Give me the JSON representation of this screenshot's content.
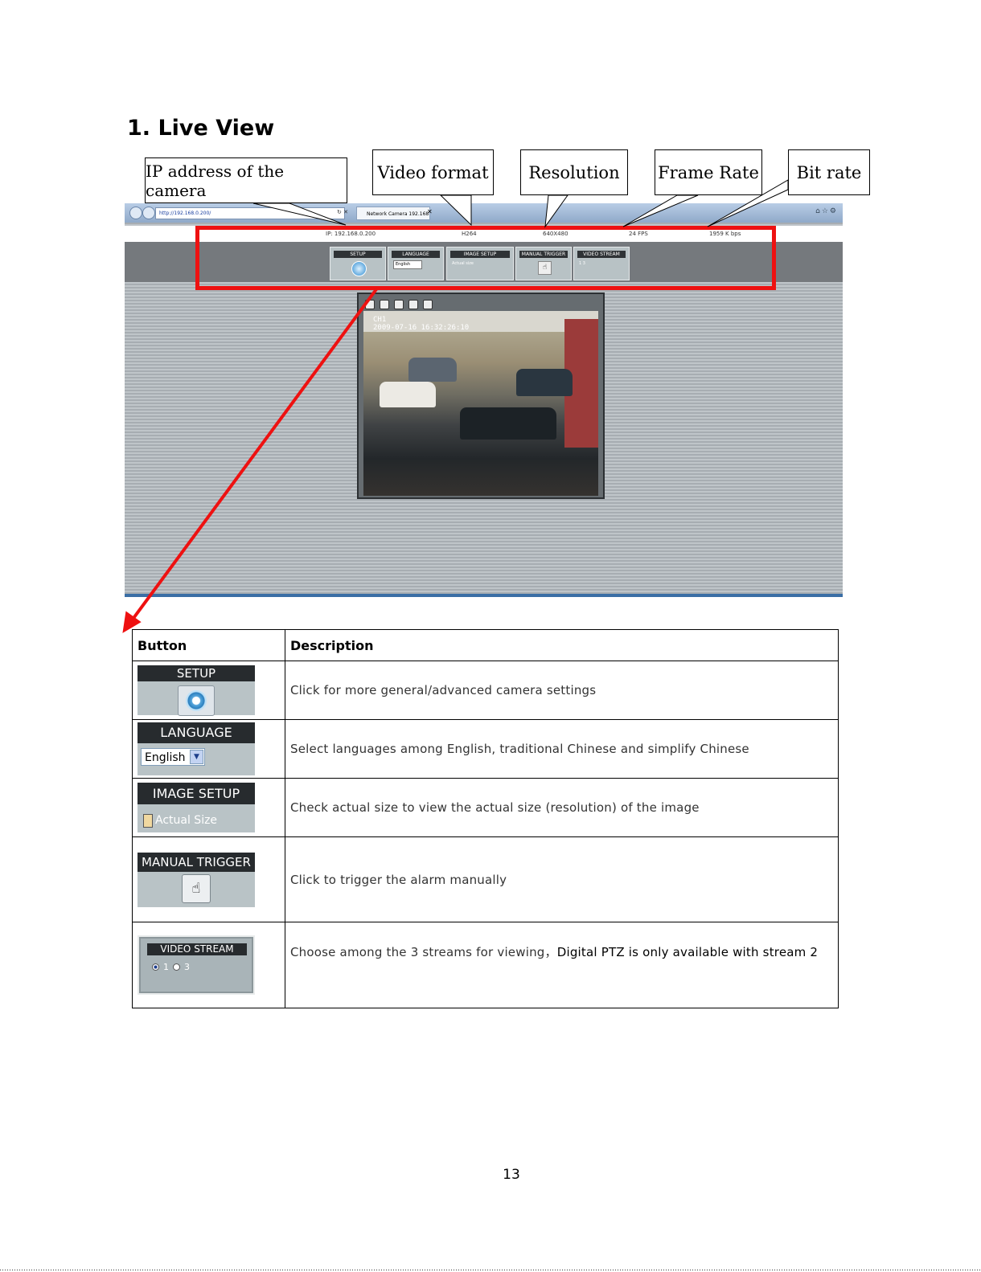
{
  "heading": "1. Live View",
  "callouts": {
    "ip": "IP address of the camera",
    "video_format": "Video format",
    "resolution": "Resolution",
    "frame_rate": "Frame Rate",
    "bit_rate": "Bit rate"
  },
  "screenshot": {
    "address_url": "http://192.168.0.200/",
    "tab_title": "Network Camera 192.168 ...",
    "status": {
      "ip": "IP: 192.168.0.200",
      "format": "H264",
      "resolution": "640X480",
      "fps": "24  FPS",
      "bitrate": "1959  K bps"
    },
    "panels": {
      "setup": "SETUP",
      "language": "LANGUAGE",
      "language_value": "English",
      "image_setup": "IMAGE SETUP",
      "image_setup_option": "Actual size",
      "manual_trigger": "MANUAL TRIGGER",
      "video_stream": "VIDEO STREAM",
      "stream_options": "1  3"
    },
    "osd_channel": "CH1",
    "osd_timestamp": "2009-07-16  16:32:26:10"
  },
  "table": {
    "headers": {
      "button": "Button",
      "description": "Description"
    },
    "rows": [
      {
        "button_label": "SETUP",
        "description": "Click for more general/advanced camera settings"
      },
      {
        "button_label": "LANGUAGE",
        "select_value": "English",
        "description": "Select languages among English, traditional Chinese and simplify Chinese"
      },
      {
        "button_label": "IMAGE SETUP",
        "checkbox_label": "Actual Size",
        "description": "Check actual size to view the actual size (resolution) of the image"
      },
      {
        "button_label": "MANUAL TRIGGER",
        "description": "Click to trigger the alarm manually"
      },
      {
        "button_label": "VIDEO STREAM",
        "radio_1": "1",
        "radio_2": "3",
        "description": "Choose among the 3 streams for viewing，",
        "description_emph": "Digital PTZ is only available with stream 2"
      }
    ]
  },
  "page_number": "13",
  "colors": {
    "highlight": "#ee1111",
    "panel_bar": "#272b2e",
    "panel_bg": "#b9c3c6"
  }
}
